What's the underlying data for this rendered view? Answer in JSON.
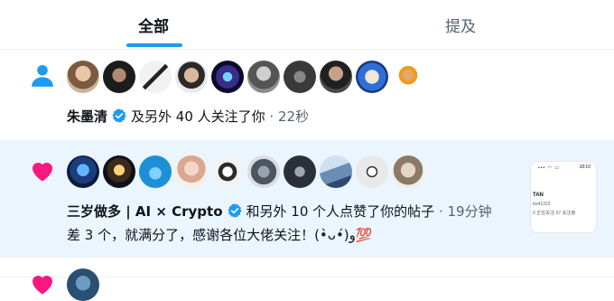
{
  "tabs": [
    {
      "label": "全部",
      "active": true
    },
    {
      "label": "提及",
      "active": false
    }
  ],
  "colors": {
    "accent": "#1d9bf0",
    "follow_icon": "#1d9bf0",
    "like_icon": "#f91880",
    "highlight_row": "#ebf5fe"
  },
  "notifications": [
    {
      "type": "follow",
      "icon": "person-icon",
      "actor_name": "朱墨清",
      "verified": true,
      "action_text": "及另外 40 人关注了你",
      "separator": "·",
      "time": "22秒",
      "avatar_count": 10
    },
    {
      "type": "like",
      "icon": "heart-icon",
      "actor_name": "三岁做多 | AI × Crypto",
      "verified": true,
      "action_text": "和另外 10 个人点赞了你的帖子",
      "separator": "·",
      "time": "19分钟",
      "post_text": "差 3 个，就满分了，感谢各位大佬关注！(•̀ᴗ•́)و💯",
      "avatar_count": 10,
      "thumbnail": {
        "status_time": "18:10",
        "name_fragment": "TAN",
        "handle_fragment": "bo41322",
        "stats_following": "",
        "stats_text": "0 正在关注   97 关注者"
      }
    }
  ]
}
